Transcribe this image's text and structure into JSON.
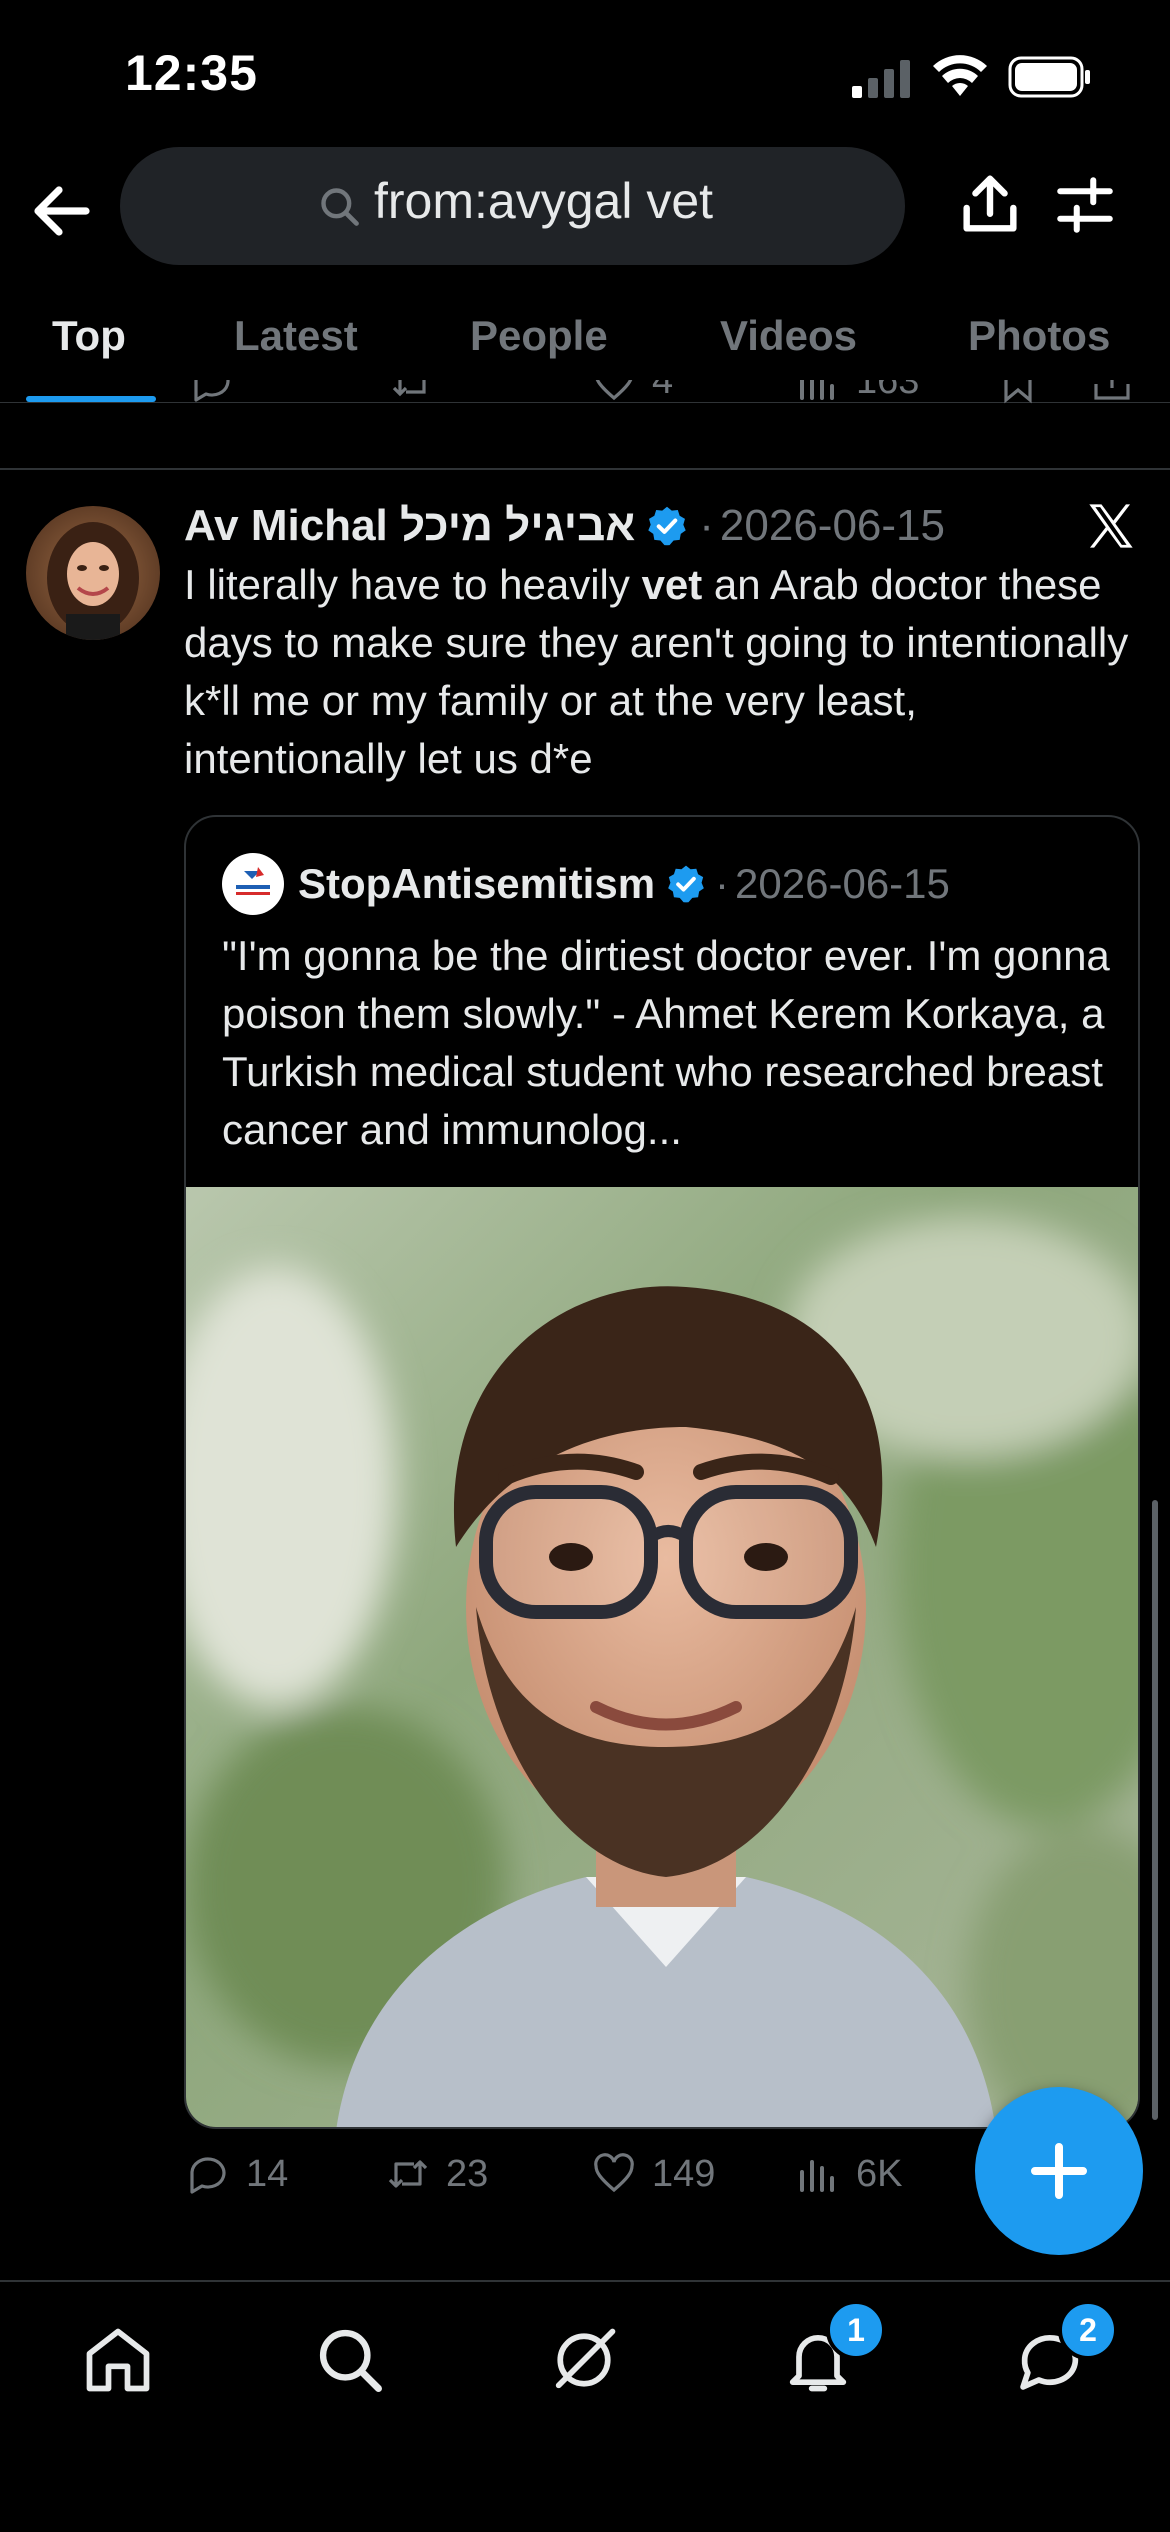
{
  "status_bar": {
    "time": "12:35"
  },
  "search": {
    "query": "from:avygal vet"
  },
  "tabs": [
    {
      "label": "Top",
      "active": true
    },
    {
      "label": "Latest"
    },
    {
      "label": "People"
    },
    {
      "label": "Videos"
    },
    {
      "label": "Photos"
    }
  ],
  "previous_tweet": {
    "likes": "4",
    "views": "163"
  },
  "tweet": {
    "author": "Av Michal אביגיל מיכל",
    "separator": "·",
    "date": "2026-06-15",
    "text_before": "I literally have to heavily ",
    "text_bold": "vet",
    "text_after": " an Arab doctor these days to make sure they aren't going to intentionally k*ll me or my family or at the very least, intentionally let us d*e",
    "quote": {
      "author": "StopAntisemitism",
      "separator": "·",
      "date": "2026-06-15",
      "text": "\"I'm gonna be the dirtiest doctor ever. I'm gonna poison them slowly.\" - Ahmet Kerem Korkaya, a Turkish medical student who researched breast cancer and immunolog..."
    },
    "actions": {
      "replies": "14",
      "reposts": "23",
      "likes": "149",
      "views": "6K"
    }
  },
  "nav": {
    "notifications_badge": "1",
    "messages_badge": "2"
  },
  "colors": {
    "accent": "#1d9bf0",
    "muted": "#71767b",
    "divider": "#2f3336"
  }
}
